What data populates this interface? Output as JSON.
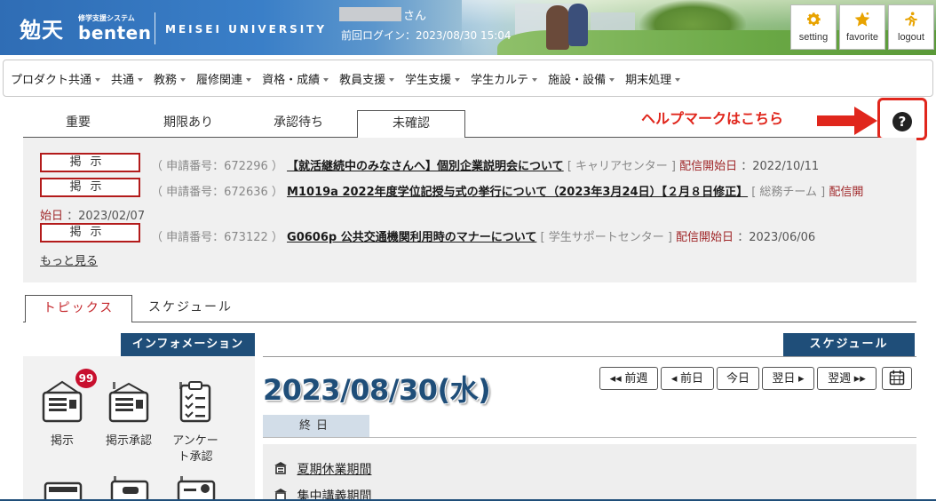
{
  "header": {
    "logo_kanji": "勉天",
    "logo_sub": "修学支援システム",
    "logo_name": "benten",
    "university": "MEISEI UNIVERSITY",
    "user_suffix": "さん",
    "last_login": "前回ログイン：2023/08/30 15:04",
    "buttons": {
      "setting": "setting",
      "favorite": "favorite",
      "logout": "logout"
    }
  },
  "nav": {
    "items": [
      "プロダクト共通",
      "共通",
      "教務",
      "履修関連",
      "資格・成績",
      "教員支援",
      "学生支援",
      "学生カルテ",
      "施設・設備",
      "期末処理"
    ]
  },
  "notice_tabs": [
    "重要",
    "期限あり",
    "承認待ち",
    "未確認"
  ],
  "help_annotation": "ヘルプマークはこちら",
  "help_icon_glyph": "?",
  "notices": [
    {
      "badge": "掲示",
      "meta": "（ 申請番号：672296 ）",
      "title": "【就活継続中のみなさんへ】個別企業説明会について",
      "org": "[ キャリアセンター ]",
      "date_label": "配信開始日",
      "date_value": "：2022/10/11"
    },
    {
      "badge": "掲示",
      "meta": "（ 申請番号：672636 ）",
      "title": "M1019a 2022年度学位記授与式の挙行について（2023年3月24日）【２月８日修正】",
      "org": "[ 総務チーム ]",
      "date_label_a": "配信開",
      "date_label_b": "始日",
      "date_value": "：2023/02/07"
    },
    {
      "badge": "掲示",
      "meta": "（ 申請番号：673122 ）",
      "title": "G0606p 公共交通機関利用時のマナーについて",
      "org": "[ 学生サポートセンター ]",
      "date_label": "配信開始日",
      "date_value": "：2023/06/06"
    }
  ],
  "more_link": "もっと見る",
  "topic_tabs": [
    "トピックス",
    "スケジュール"
  ],
  "info": {
    "header": "インフォメーション",
    "unread_count": "99",
    "items": [
      {
        "label": "掲示"
      },
      {
        "label": "掲示承認"
      },
      {
        "label_a": "アンケー",
        "label_b": "ト承認"
      }
    ]
  },
  "schedule": {
    "header": "スケジュール",
    "date": "2023/08/30(水)",
    "buttons": {
      "prev_week": "◂◂ 前週",
      "prev_day": "◂ 前日",
      "today": "今日",
      "next_day": "翌日 ▸",
      "next_week": "翌週 ▸▸"
    },
    "allday_label": "終日",
    "events": [
      "夏期休業期間",
      "集中講義期間"
    ]
  },
  "colors": {
    "accent_navy": "#1f4e79",
    "alert_red": "#e0261c",
    "badge_red": "#b31b1b",
    "date_label_red": "#a0282a"
  }
}
